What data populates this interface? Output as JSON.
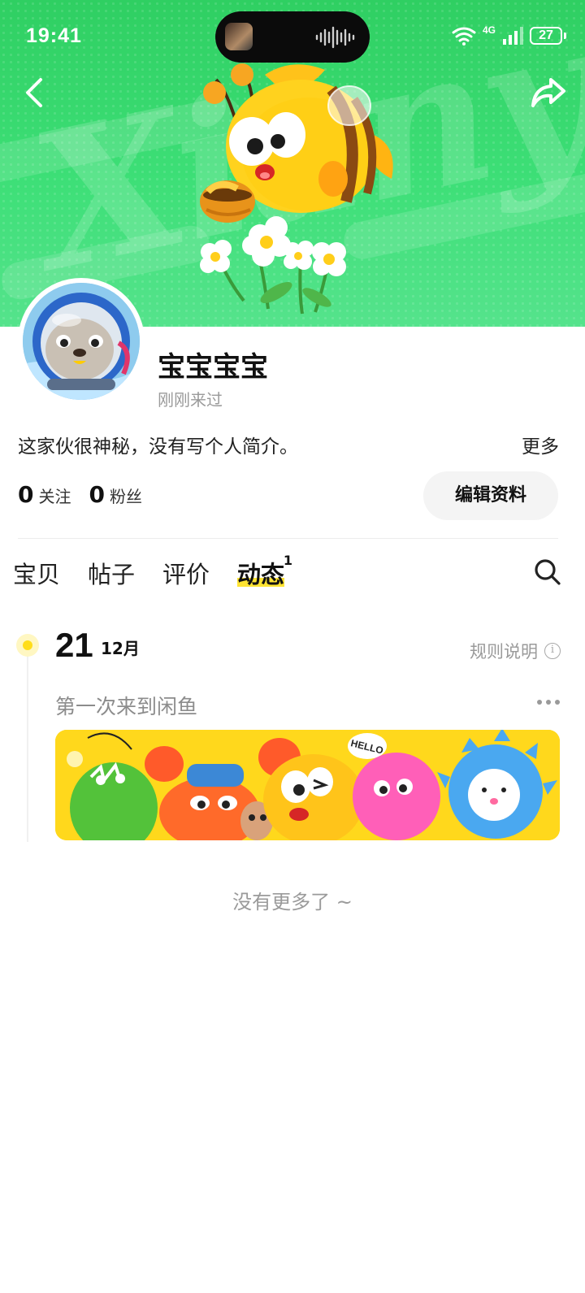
{
  "status_bar": {
    "time": "19:41",
    "network": "4G",
    "battery": "27"
  },
  "header": {
    "banner_watermark": "Xianyu",
    "back_icon": "chevron-left-icon",
    "share_icon": "share-arrow-icon"
  },
  "profile": {
    "username": "宝宝宝宝",
    "last_seen": "刚刚来过",
    "bio": "这家伙很神秘，没有写个人简介。",
    "more_label": "更多",
    "following_count": "0",
    "following_label": "关注",
    "followers_count": "0",
    "followers_label": "粉丝",
    "edit_button": "编辑资料"
  },
  "tabs": [
    {
      "label": "宝贝",
      "active": false
    },
    {
      "label": "帖子",
      "active": false
    },
    {
      "label": "评价",
      "active": false
    },
    {
      "label": "动态",
      "active": true,
      "badge": "1"
    }
  ],
  "timeline": {
    "day": "21",
    "month": "12月",
    "rules_label": "规则说明",
    "event_title": "第一次来到闲鱼",
    "banner_bubble_text": "HELLO"
  },
  "footer": {
    "end_text": "没有更多了 ~"
  },
  "colors": {
    "banner_green": "#3ddf77",
    "accent_yellow": "#ffe433",
    "event_banner_yellow": "#ffd81c"
  }
}
